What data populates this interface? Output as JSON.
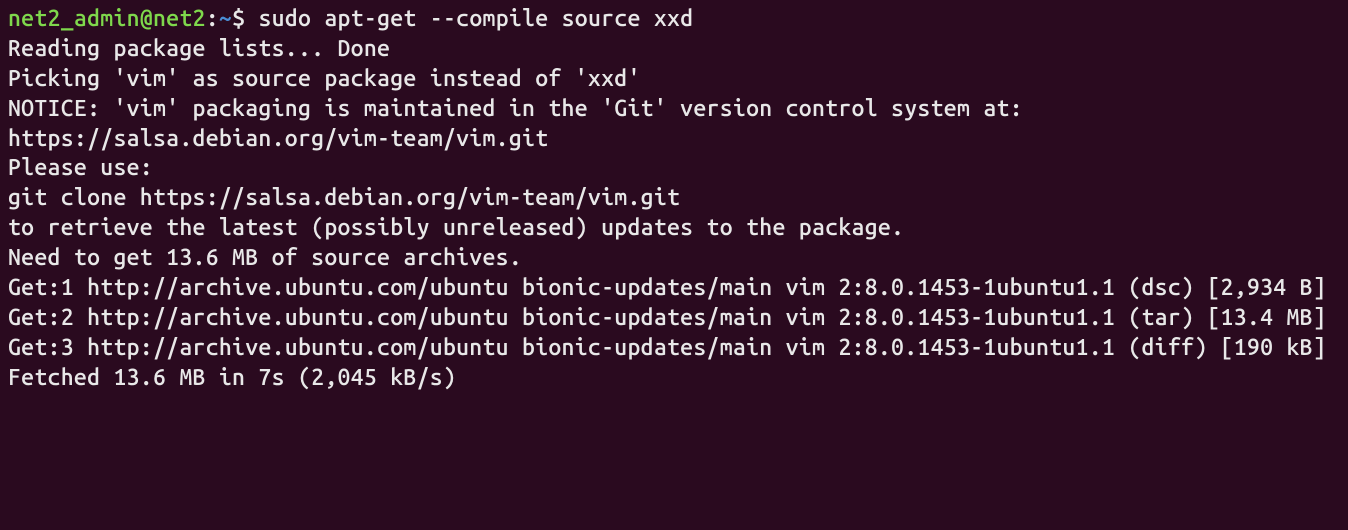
{
  "prompt": {
    "user_host": "net2_admin@net2",
    "separator": ":",
    "path": "~",
    "dollar": "$ ",
    "command": "sudo apt-get --compile  source xxd"
  },
  "output": {
    "l1": "Reading package lists... Done",
    "l2": "Picking 'vim' as source package instead of 'xxd'",
    "l3": "NOTICE: 'vim' packaging is maintained in the 'Git' version control system at:",
    "l4": "https://salsa.debian.org/vim-team/vim.git",
    "l5": "Please use:",
    "l6": "git clone https://salsa.debian.org/vim-team/vim.git",
    "l7": "to retrieve the latest (possibly unreleased) updates to the package.",
    "l8": "Need to get 13.6 MB of source archives.",
    "l9": "Get:1 http://archive.ubuntu.com/ubuntu bionic-updates/main vim 2:8.0.1453-1ubuntu1.1 (dsc) [2,934 B]",
    "l10": "Get:2 http://archive.ubuntu.com/ubuntu bionic-updates/main vim 2:8.0.1453-1ubuntu1.1 (tar) [13.4 MB]",
    "l11": "Get:3 http://archive.ubuntu.com/ubuntu bionic-updates/main vim 2:8.0.1453-1ubuntu1.1 (diff) [190 kB]",
    "l12": "Fetched 13.6 MB in 7s (2,045 kB/s)"
  }
}
